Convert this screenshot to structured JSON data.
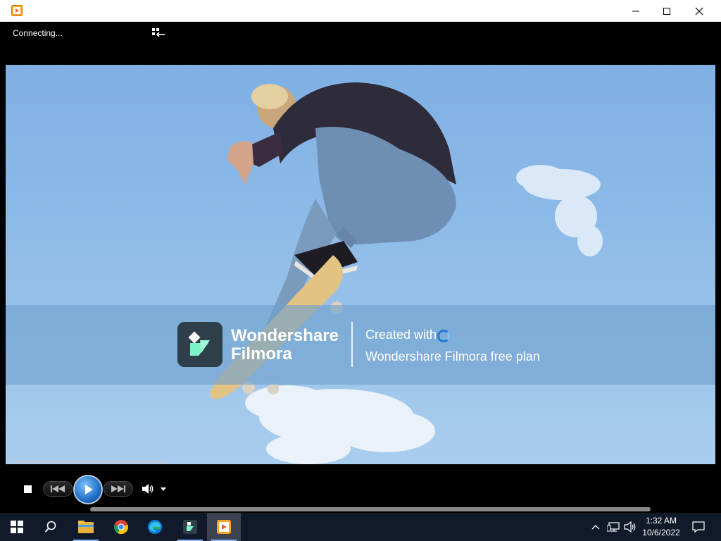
{
  "window": {
    "status": "Connecting...",
    "icons": {
      "app": "media-player-icon",
      "minimize": "minimize-icon",
      "maximize": "maximize-icon",
      "close": "close-icon",
      "switch_view": "switch-to-library-icon"
    }
  },
  "video": {
    "watermark": {
      "brand_line1": "Wondershare",
      "brand_line2": "Filmora",
      "created_with": "Created with",
      "plan": "Wondershare Filmora free plan"
    },
    "seek_progress": 0.22
  },
  "controls": {
    "icons": [
      "stop-icon",
      "previous-icon",
      "play-icon",
      "next-icon",
      "volume-icon",
      "volume-dropdown-icon"
    ]
  },
  "taskbar": {
    "apps": [
      "start-icon",
      "search-icon",
      "file-explorer-icon",
      "chrome-icon",
      "edge-icon",
      "filmora-icon",
      "media-player-icon"
    ],
    "active_app": "media-player-icon",
    "clock": {
      "time": "1:32 AM",
      "date": "10/6/2022"
    },
    "tray_icons": [
      "show-hidden-icons-icon",
      "network-icon",
      "speaker-icon",
      "notifications-icon"
    ]
  },
  "colors": {
    "accent": "#1f6fc6",
    "taskbar": "#101a2a",
    "sky": "#8dbbe8"
  }
}
